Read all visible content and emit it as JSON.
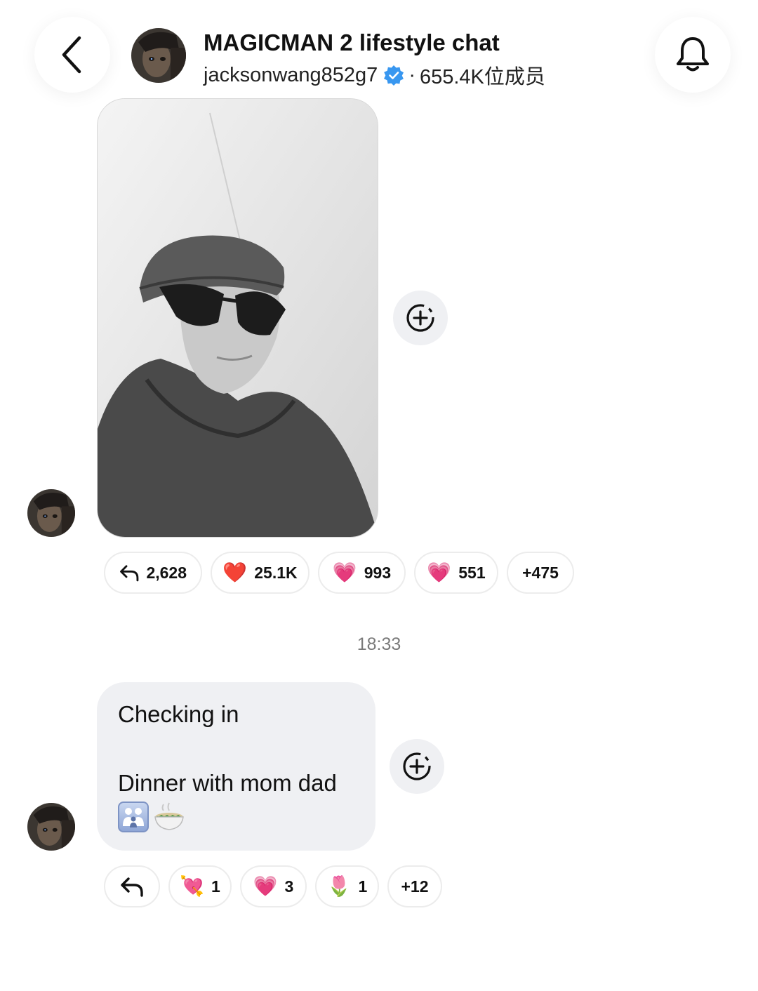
{
  "header": {
    "title": "MAGICMAN 2 lifestyle chat",
    "username": "jacksonwang852g7",
    "separator": "·",
    "members": "655.4K位成员"
  },
  "icons": {
    "back": "chevron-left-icon",
    "bell": "bell-icon",
    "verified": "verified-badge-icon",
    "add_reaction": "add-reaction-icon",
    "reply": "reply-arrow-icon"
  },
  "colors": {
    "verified_blue": "#3897f0",
    "bubble_bg": "#eff0f3",
    "pill_border": "#ececec"
  },
  "messages": [
    {
      "type": "photo",
      "reactions": {
        "reply_count": "2,628",
        "items": [
          {
            "emoji": "❤️",
            "count": "25.1K"
          },
          {
            "emoji": "💗",
            "count": "993"
          },
          {
            "emoji": "💗",
            "count": "551"
          }
        ],
        "more": "+475"
      }
    },
    {
      "type": "text",
      "line1": "Checking in",
      "line2": "Dinner with mom dad",
      "emojis": [
        "family",
        "bowl"
      ],
      "reactions": {
        "items": [
          {
            "emoji": "💘",
            "count": "1"
          },
          {
            "emoji": "💗",
            "count": "3"
          },
          {
            "emoji": "🌷",
            "count": "1"
          }
        ],
        "more": "+12"
      }
    }
  ],
  "timestamp": "18:33"
}
